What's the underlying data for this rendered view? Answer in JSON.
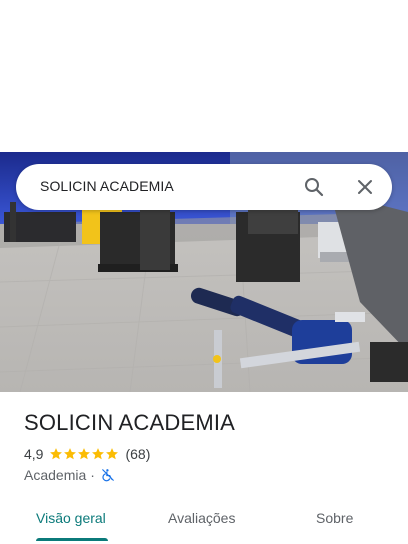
{
  "search": {
    "query": "SOLICIN ACADEMIA"
  },
  "place": {
    "name": "SOLICIN ACADEMIA",
    "rating": "4,9",
    "stars": 5,
    "review_count": "(68)",
    "category": "Academia",
    "separator": "·",
    "accessibility_icon": "wheelchair-not-accessible-icon"
  },
  "tabs": [
    {
      "label": "Visão geral",
      "active": true
    },
    {
      "label": "Avaliações",
      "active": false
    },
    {
      "label": "Sobre",
      "active": false
    }
  ],
  "colors": {
    "accent": "#0b7a7a",
    "star": "#fbbc04",
    "access_icon": "#1a73e8"
  }
}
